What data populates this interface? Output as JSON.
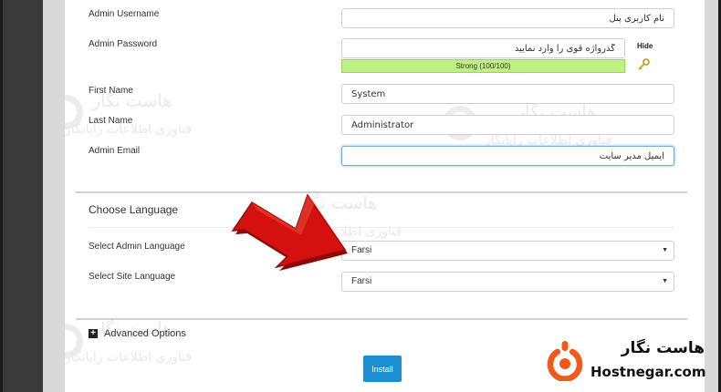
{
  "form": {
    "username": {
      "label": "Admin Username",
      "value": "نام کاربری پنل"
    },
    "password": {
      "label": "Admin Password",
      "value": "گذرواژه قوی را وارد نمایید",
      "strength": "Strong (100/100)",
      "hide_label": "Hide"
    },
    "first_name": {
      "label": "First Name",
      "value": "System"
    },
    "last_name": {
      "label": "Last Name",
      "value": "Administrator"
    },
    "email": {
      "label": "Admin Email",
      "value": "ایمیل مدیر سایت"
    }
  },
  "language": {
    "title": "Choose Language",
    "admin": {
      "label": "Select Admin Language",
      "selected": "Farsi"
    },
    "site": {
      "label": "Select Site Language",
      "selected": "Farsi"
    }
  },
  "advanced": {
    "label": "Advanced Options",
    "icon": "plus-square-icon"
  },
  "install_label": "Install",
  "watermark": {
    "line1": "هاست نگار",
    "line2": "فناوری اطلاعات رایانگار"
  },
  "logo": {
    "fa": "هاست نگار",
    "en": "Hostnegar.com"
  },
  "colors": {
    "strength_bg": "#bfef85",
    "install_bg": "#1d8fd1",
    "arrow": "#d4110e",
    "logo_orange": "#ef5a1a"
  }
}
